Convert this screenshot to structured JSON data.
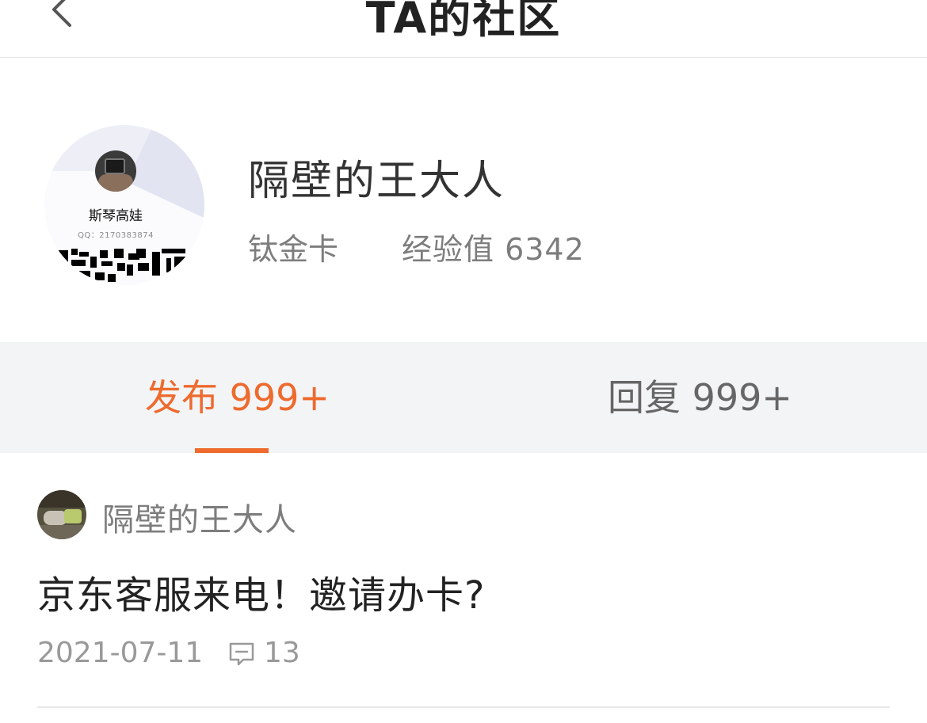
{
  "header": {
    "title": "TA的社区"
  },
  "profile": {
    "avatar_name": "斯琴高娃",
    "avatar_qq": "QQ：2170383874",
    "username": "隔壁的王大人",
    "level": "钛金卡",
    "exp": "经验值 6342"
  },
  "tabs": [
    {
      "label": "发布 999+",
      "active": true
    },
    {
      "label": "回复 999+",
      "active": false
    }
  ],
  "posts": [
    {
      "author": "隔壁的王大人",
      "title": "京东客服来电！邀请办卡?",
      "date": "2021-07-11",
      "comments": "13"
    }
  ],
  "colors": {
    "accent": "#ee6a2d",
    "tab_bg": "#f3f4f6"
  }
}
